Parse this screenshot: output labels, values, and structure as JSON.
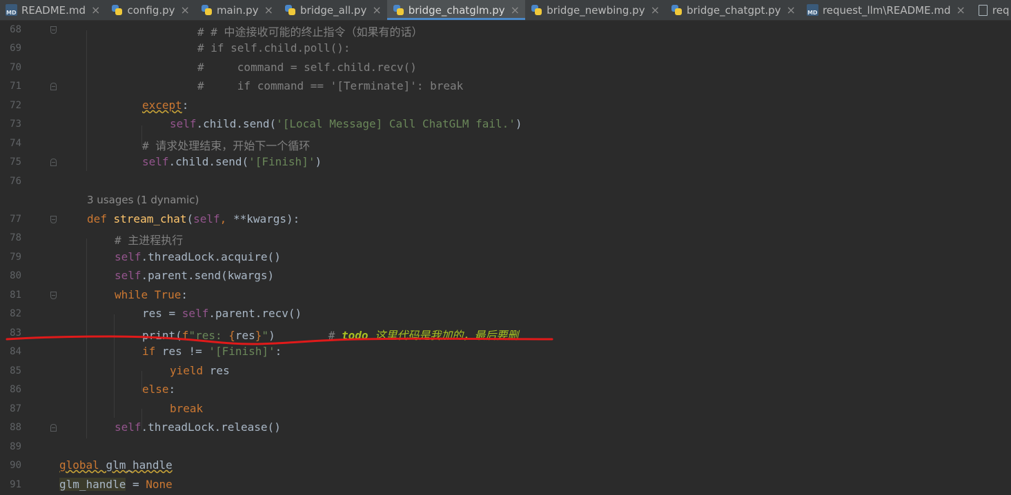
{
  "tabs": [
    {
      "label": "README.md",
      "icon": "markdown-file-icon",
      "active": false
    },
    {
      "label": "config.py",
      "icon": "python-file-icon",
      "active": false
    },
    {
      "label": "main.py",
      "icon": "python-file-icon",
      "active": false
    },
    {
      "label": "bridge_all.py",
      "icon": "python-file-icon",
      "active": false
    },
    {
      "label": "bridge_chatglm.py",
      "icon": "python-file-icon",
      "active": true
    },
    {
      "label": "bridge_newbing.py",
      "icon": "python-file-icon",
      "active": false
    },
    {
      "label": "bridge_chatgpt.py",
      "icon": "python-file-icon",
      "active": false
    },
    {
      "label": "request_llm\\README.md",
      "icon": "markdown-file-icon",
      "active": false
    },
    {
      "label": "req",
      "icon": "file-icon",
      "active": false
    }
  ],
  "close_glyph": "×",
  "usages_hint": "3 usages (1 dynamic)",
  "lines": [
    {
      "n": "68",
      "tokens": [
        [
          "c",
          "# # 中途接收可能的终止指令（如果有的话）"
        ]
      ]
    },
    {
      "n": "69",
      "tokens": [
        [
          "c",
          "# if self.child.poll():"
        ]
      ]
    },
    {
      "n": "70",
      "tokens": [
        [
          "c",
          "#     command = self.child.recv()"
        ]
      ]
    },
    {
      "n": "71",
      "tokens": [
        [
          "c",
          "#     if command == '[Terminate]': break"
        ]
      ]
    },
    {
      "n": "72",
      "tokens": [
        [
          "kw wavy",
          "except"
        ],
        [
          "",
          ":"
        ]
      ]
    },
    {
      "n": "73",
      "tokens": [
        [
          "sf",
          "self"
        ],
        [
          "",
          ".child.send("
        ],
        [
          "st",
          "'[Local Message] Call ChatGLM fail.'"
        ],
        [
          "",
          ")"
        ]
      ]
    },
    {
      "n": "74",
      "tokens": [
        [
          "c",
          "# 请求处理结束，开始下一个循环"
        ]
      ]
    },
    {
      "n": "75",
      "tokens": [
        [
          "sf",
          "self"
        ],
        [
          "",
          ".child.send("
        ],
        [
          "st",
          "'[Finish]'"
        ],
        [
          "",
          ")"
        ]
      ]
    },
    {
      "n": "76",
      "tokens": []
    },
    {
      "n": "77",
      "tokens": [
        [
          "kw",
          "def "
        ],
        [
          "fn",
          "stream_chat"
        ],
        [
          "",
          "("
        ],
        [
          "sf",
          "self"
        ],
        [
          "kw",
          ", "
        ],
        [
          "",
          "**kwargs):"
        ]
      ]
    },
    {
      "n": "78",
      "tokens": [
        [
          "c",
          "# 主进程执行"
        ]
      ]
    },
    {
      "n": "79",
      "tokens": [
        [
          "sf",
          "self"
        ],
        [
          "",
          ".threadLock.acquire()"
        ]
      ]
    },
    {
      "n": "80",
      "tokens": [
        [
          "sf",
          "self"
        ],
        [
          "",
          ".parent.send(kwargs)"
        ]
      ]
    },
    {
      "n": "81",
      "tokens": [
        [
          "kw",
          "while True"
        ],
        [
          "",
          ":"
        ]
      ]
    },
    {
      "n": "82",
      "tokens": [
        [
          "",
          "res = "
        ],
        [
          "sf",
          "self"
        ],
        [
          "",
          ".parent.recv()"
        ]
      ]
    },
    {
      "n": "83",
      "tokens": [
        [
          "",
          "print("
        ],
        [
          "kw",
          "f"
        ],
        [
          "st",
          "\"res: "
        ],
        [
          "kw",
          "{"
        ],
        [
          "",
          "res"
        ],
        [
          "kw",
          "}"
        ],
        [
          "st",
          "\""
        ],
        [
          "",
          ")        "
        ],
        [
          "c",
          "# "
        ],
        [
          "todo",
          "todo"
        ],
        [
          "todot",
          " 这里代码是我加的，最后要删"
        ]
      ]
    },
    {
      "n": "84",
      "tokens": [
        [
          "kw",
          "if "
        ],
        [
          "",
          "res != "
        ],
        [
          "st",
          "'[Finish]'"
        ],
        [
          "",
          ":"
        ]
      ]
    },
    {
      "n": "85",
      "tokens": [
        [
          "kw",
          "yield "
        ],
        [
          "",
          "res"
        ]
      ]
    },
    {
      "n": "86",
      "tokens": [
        [
          "kw",
          "else"
        ],
        [
          "",
          ":"
        ]
      ]
    },
    {
      "n": "87",
      "tokens": [
        [
          "kw",
          "break"
        ]
      ]
    },
    {
      "n": "88",
      "tokens": [
        [
          "sf",
          "self"
        ],
        [
          "",
          ".threadLock.release()"
        ]
      ]
    },
    {
      "n": "89",
      "tokens": []
    },
    {
      "n": "90",
      "tokens": [
        [
          "kw wavy",
          "global "
        ],
        [
          "wavy",
          "glm_handle"
        ]
      ]
    },
    {
      "n": "91",
      "tokens": [
        [
          "hl",
          "glm_handle"
        ],
        [
          "",
          " = "
        ],
        [
          "kw",
          "None"
        ]
      ]
    }
  ]
}
